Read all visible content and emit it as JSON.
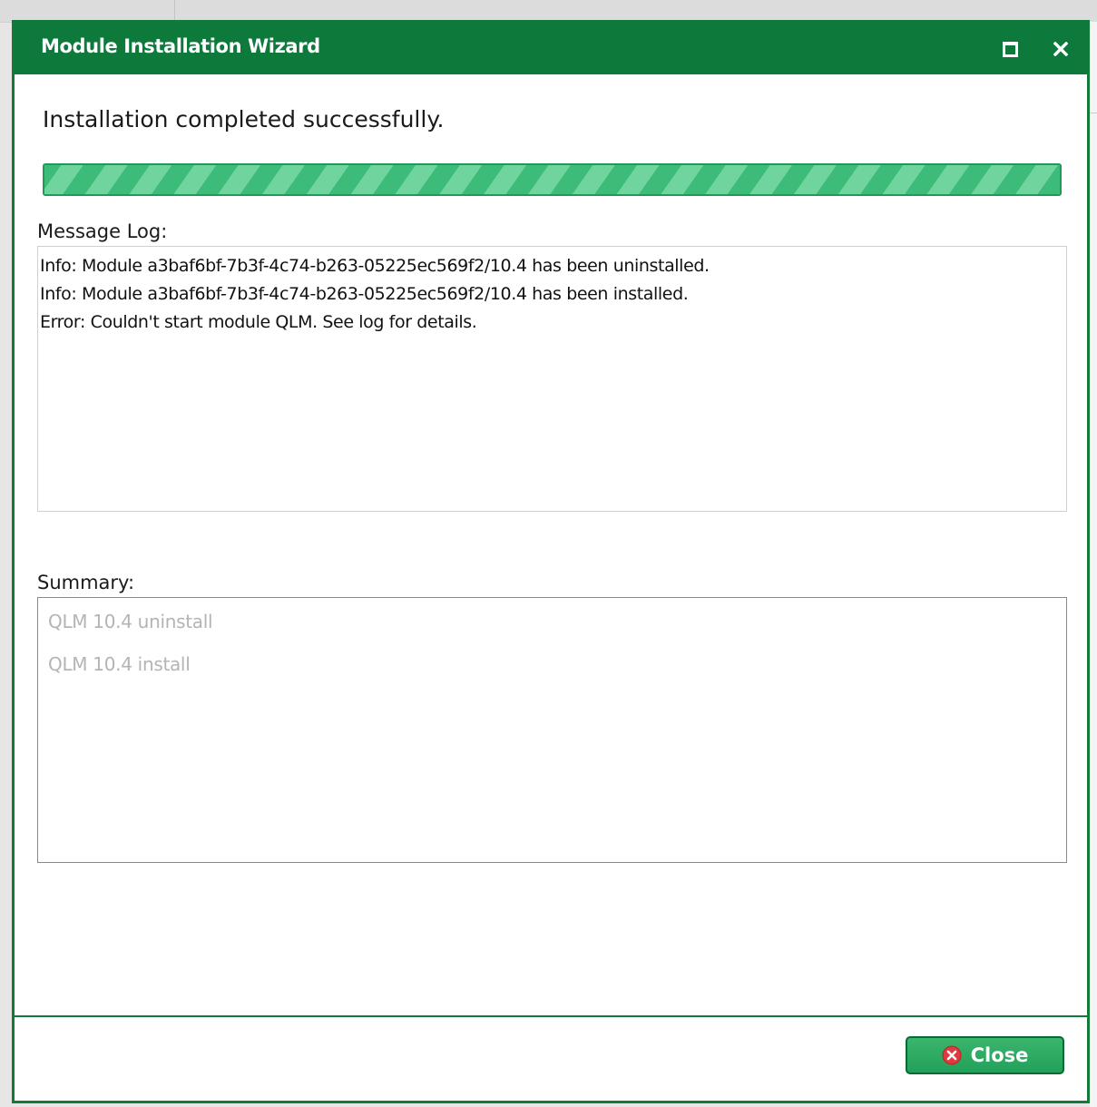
{
  "dialog": {
    "title": "Module Installation Wizard",
    "status": "Installation completed successfully.",
    "progress_fraction": 1.0,
    "message_log_label": "Message Log:",
    "message_log": [
      "Info: Module a3baf6bf-7b3f-4c74-b263-05225ec569f2/10.4 has been uninstalled.",
      "Info: Module a3baf6bf-7b3f-4c74-b263-05225ec569f2/10.4 has been installed.",
      "Error: Couldn't start module QLM. See log for details."
    ],
    "summary_label": "Summary:",
    "summary_items": [
      "QLM 10.4 uninstall",
      "QLM 10.4 install"
    ],
    "close_label": "Close"
  },
  "colors": {
    "title_bar": "#0d7a3c",
    "progress": "#4cc685",
    "close_button": "#2aa862",
    "close_icon": "#e0393e"
  },
  "icons": {
    "maximize": "maximize-icon",
    "close_window": "close-icon",
    "close_button": "error-circle-icon"
  }
}
